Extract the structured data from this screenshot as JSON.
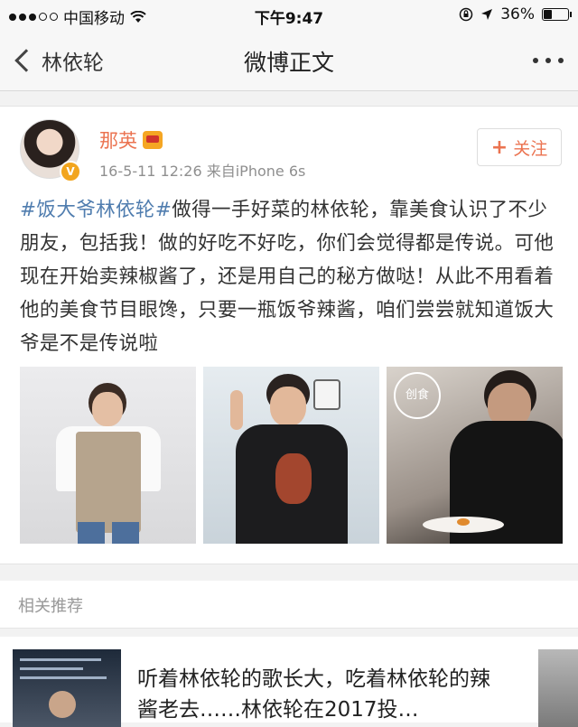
{
  "status_bar": {
    "carrier": "中国移动",
    "time": "下午9:47",
    "battery": "36%",
    "battery_level": 0.36
  },
  "nav": {
    "back_label": "林依轮",
    "title": "微博正文"
  },
  "post": {
    "username": "那英",
    "timestamp": "16-5-11 12:26",
    "source": "来自iPhone 6s",
    "follow_label": "关注",
    "hashtag": "#饭大爷林依轮#",
    "body": "做得一手好菜的林依轮，靠美食认识了不少朋友，包括我！做的好吃不好吃，你们会觉得都是传说。可他现在开始卖辣椒酱了，还是用自己的秘方做哒！从此不用看着他的美食节目眼馋，只要一瓶饭爷辣酱，咱们尝尝就知道饭大爷是不是传说啦",
    "photo3_logo": "创食"
  },
  "related": {
    "header": "相关推荐",
    "item_title": "听着林依轮的歌长大，吃着林依轮的辣酱老去……林依轮在2017投…"
  },
  "icons": {
    "wifi": "wifi-icon",
    "location": "location-arrow-icon",
    "lock": "orientation-lock-icon",
    "verified": "verified-badge-icon",
    "member": "vip-crown-icon"
  },
  "colors": {
    "username": "#eb7350",
    "hashtag": "#507daf",
    "follow": "#eb7350",
    "verified": "#f2a51e"
  }
}
